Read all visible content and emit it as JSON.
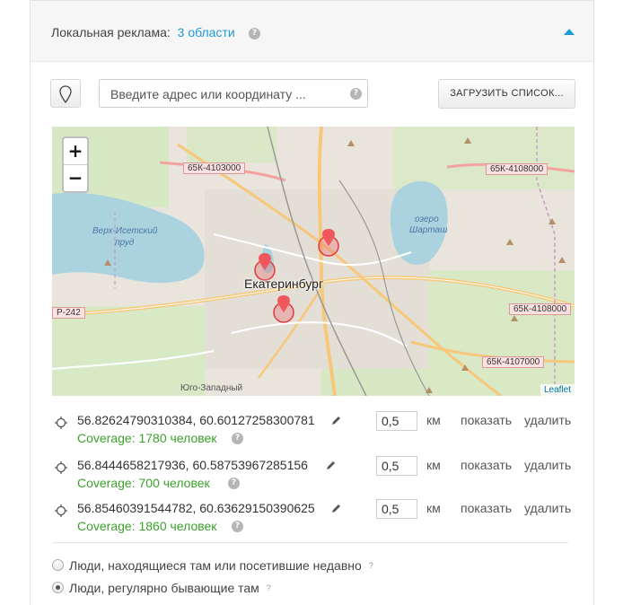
{
  "header": {
    "label": "Локальная реклама:",
    "link": "3 области"
  },
  "search": {
    "placeholder": "Введите адрес или координату ...",
    "load_button": "ЗАГРУЗИТЬ СПИСОК..."
  },
  "map": {
    "zoom_in": "+",
    "zoom_out": "−",
    "attribution": "Leaflet",
    "labels": {
      "city": "Екатеринбург",
      "road_1": "65К-4103000",
      "road_2": "65К-4108000",
      "road_3": "Р-242",
      "road_4": "65К-4108000",
      "road_5": "65К-4107000",
      "lake_1a": "Верх-Исетский",
      "lake_1b": "пруд",
      "lake_2a": "озеро",
      "lake_2b": "Шарташ",
      "district": "Юго-Западный"
    }
  },
  "locations": [
    {
      "coords": "56.82624790310384,  60.60127258300781",
      "coverage": "Coverage: 1780 человек",
      "radius": "0,5",
      "unit": "км",
      "show": "показать",
      "delete": "удалить"
    },
    {
      "coords": "56.8444658217936,  60.58753967285156",
      "coverage": "Coverage: 700 человек",
      "radius": "0,5",
      "unit": "км",
      "show": "показать",
      "delete": "удалить"
    },
    {
      "coords": "56.85460391544782,  60.63629150390625",
      "coverage": "Coverage: 1860 человек",
      "radius": "0,5",
      "unit": "км",
      "show": "показать",
      "delete": "удалить"
    }
  ],
  "audience": {
    "option_recent": "Люди, находящиеся там или посетившие недавно",
    "option_regular": "Люди, регулярно бывающие там",
    "selected": "option_regular",
    "help": "?"
  },
  "colors": {
    "accent": "#1e9bd7",
    "coverage": "#3aa22a",
    "marker": "#f0575d"
  }
}
